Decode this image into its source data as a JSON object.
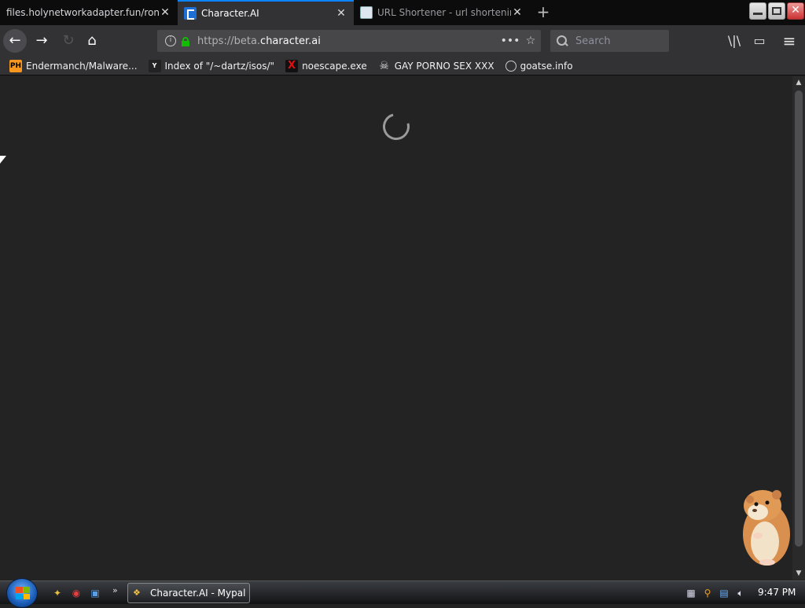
{
  "tabs": [
    {
      "label": "files.holynetworkadapter.fun/ronc",
      "close": "✕"
    },
    {
      "label": "Character.AI",
      "close": "✕"
    },
    {
      "label": "URL Shortener - url shortening",
      "close": "✕"
    }
  ],
  "new_tab": "+",
  "window_buttons": {
    "minimize": "",
    "maximize": "",
    "close": "✕"
  },
  "nav": {
    "back": "←",
    "forward": "→",
    "home": "⌂",
    "url_prefix": "https://beta.",
    "url_domain": "character.ai",
    "page_actions": "•••",
    "bookmark_star": "☆",
    "search_placeholder": "Search",
    "library": "\\|\\",
    "sidebar": "▭",
    "menu": "≡"
  },
  "bookmarks": [
    {
      "icon": "PH",
      "label": "Endermanch/Malware..."
    },
    {
      "icon": "Y",
      "label": "Index of \"/~dartz/isos/\""
    },
    {
      "icon": "X",
      "label": "noescape.exe"
    },
    {
      "icon": "☠",
      "label": "GAY PORNO SEX XXX"
    },
    {
      "icon": "",
      "label": "goatse.info"
    }
  ],
  "scrollbar": {
    "up": "▲",
    "down": "▼"
  },
  "taskbar": {
    "quick_launch_more": "»",
    "task_button": "Character.AI - Mypal",
    "task_icon": "❖",
    "clock": "9:47 PM"
  },
  "colors": {
    "page_bg": "#232323",
    "toolbar_bg": "#323234",
    "tab_accent": "#0a84ff",
    "secure_lock": "#12bc00"
  }
}
